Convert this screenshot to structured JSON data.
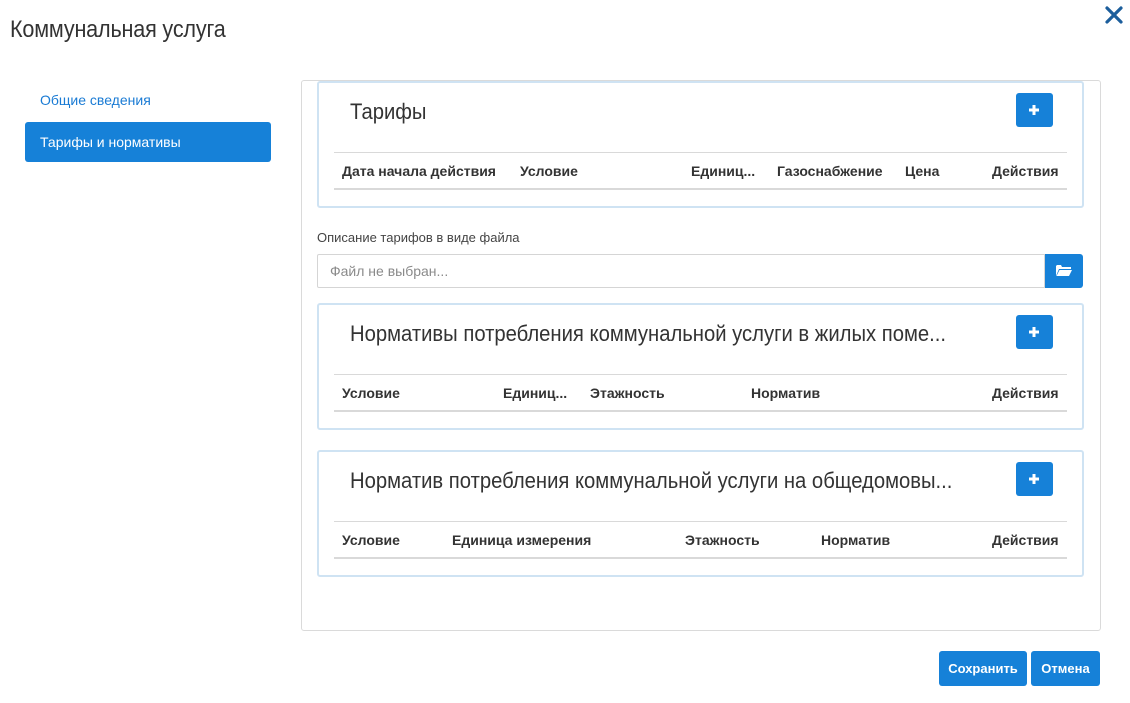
{
  "dialog": {
    "title": "Коммунальная услуга"
  },
  "sidebar": {
    "items": [
      {
        "label": "Общие сведения"
      },
      {
        "label": "Тарифы и нормативы"
      }
    ]
  },
  "tariffs": {
    "title": "Тарифы",
    "columns": [
      "Дата начала действия",
      "Условие",
      "Единица измерения",
      "Газоснабжение",
      "Цена",
      "Действия"
    ],
    "visible_columns": [
      "Дата начала действия",
      "Условие",
      "Единиц...",
      "Газоснабжение",
      "Цена",
      "Действия"
    ]
  },
  "file": {
    "label": "Описание тарифов в виде файла",
    "placeholder": "Файл не выбран..."
  },
  "residential_norms": {
    "title": "Нормативы потребления коммунальной услуги в жилых поме...",
    "columns": [
      "Условие",
      "Единиц...",
      "Этажность",
      "Норматив",
      "Действия"
    ]
  },
  "common_norms": {
    "title": "Норматив потребления коммунальной услуги на общедомовы...",
    "columns": [
      "Условие",
      "Единица измерения",
      "Этажность",
      "Норматив",
      "Действия"
    ]
  },
  "footer": {
    "save_label": "Сохранить",
    "cancel_label": "Отмена"
  },
  "colors": {
    "accent": "#1681d8",
    "section_border": "#cfe3f3",
    "close_icon": "#1c5e9c"
  },
  "icons": {
    "close": "close-icon",
    "add": "plus-icon",
    "file": "folder-open-icon"
  }
}
